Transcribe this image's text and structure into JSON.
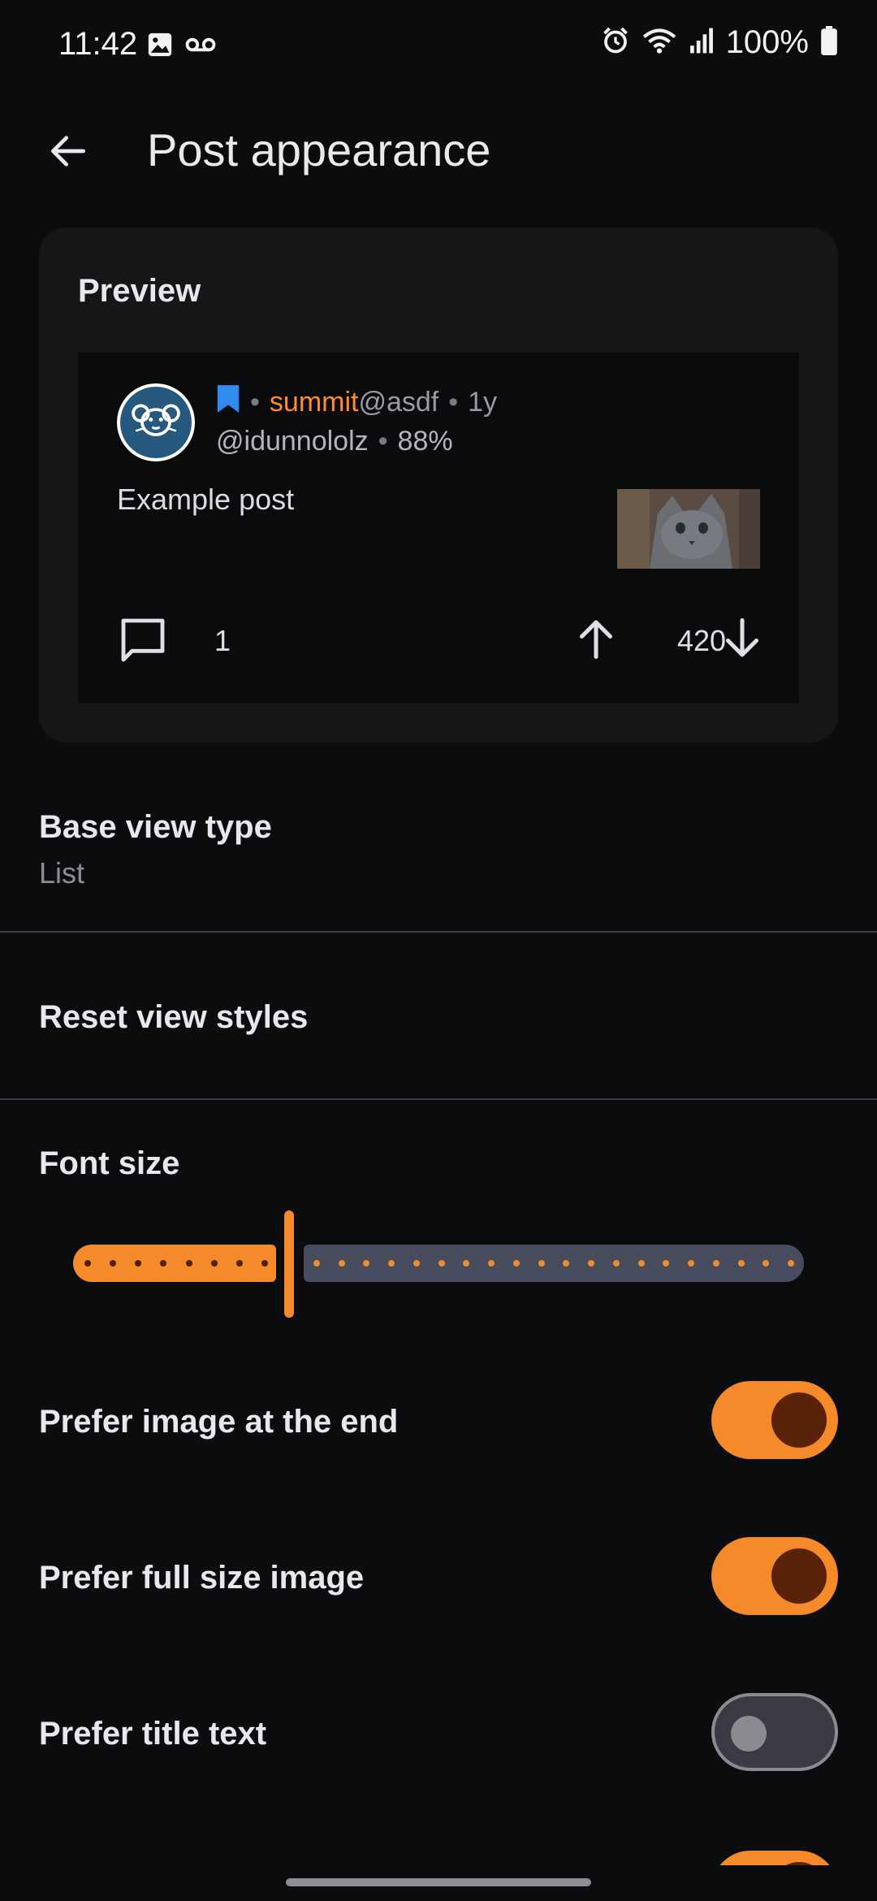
{
  "status_bar": {
    "time": "11:42",
    "left_icons": [
      "image-icon",
      "voicemail-icon"
    ],
    "right_icons": [
      "alarm-icon",
      "wifi-icon",
      "signal-icon"
    ],
    "battery": "100%"
  },
  "app_bar": {
    "title": "Post appearance",
    "back_icon": "back-arrow-icon"
  },
  "preview": {
    "section_title": "Preview",
    "post": {
      "community": "summit",
      "instance": "@asdf",
      "age": "1y",
      "author": "@idunnololz",
      "upvote_ratio": "88%",
      "title": "Example post",
      "comments": "1",
      "score": "420",
      "bookmark_color": "#2f8bf0"
    }
  },
  "settings": {
    "base_view": {
      "label": "Base view type",
      "value": "List"
    },
    "reset": {
      "label": "Reset view styles"
    },
    "font_size": {
      "label": "Font size",
      "level_fraction": 0.3,
      "steps_total": 28,
      "steps_before": 8
    },
    "toggles": [
      {
        "label": "Prefer image at the end",
        "on": true
      },
      {
        "label": "Prefer full size image",
        "on": true
      },
      {
        "label": "Prefer title text",
        "on": false
      }
    ]
  },
  "colors": {
    "accent": "#f58a2a",
    "background": "#0b0c0e",
    "card": "#151618"
  }
}
